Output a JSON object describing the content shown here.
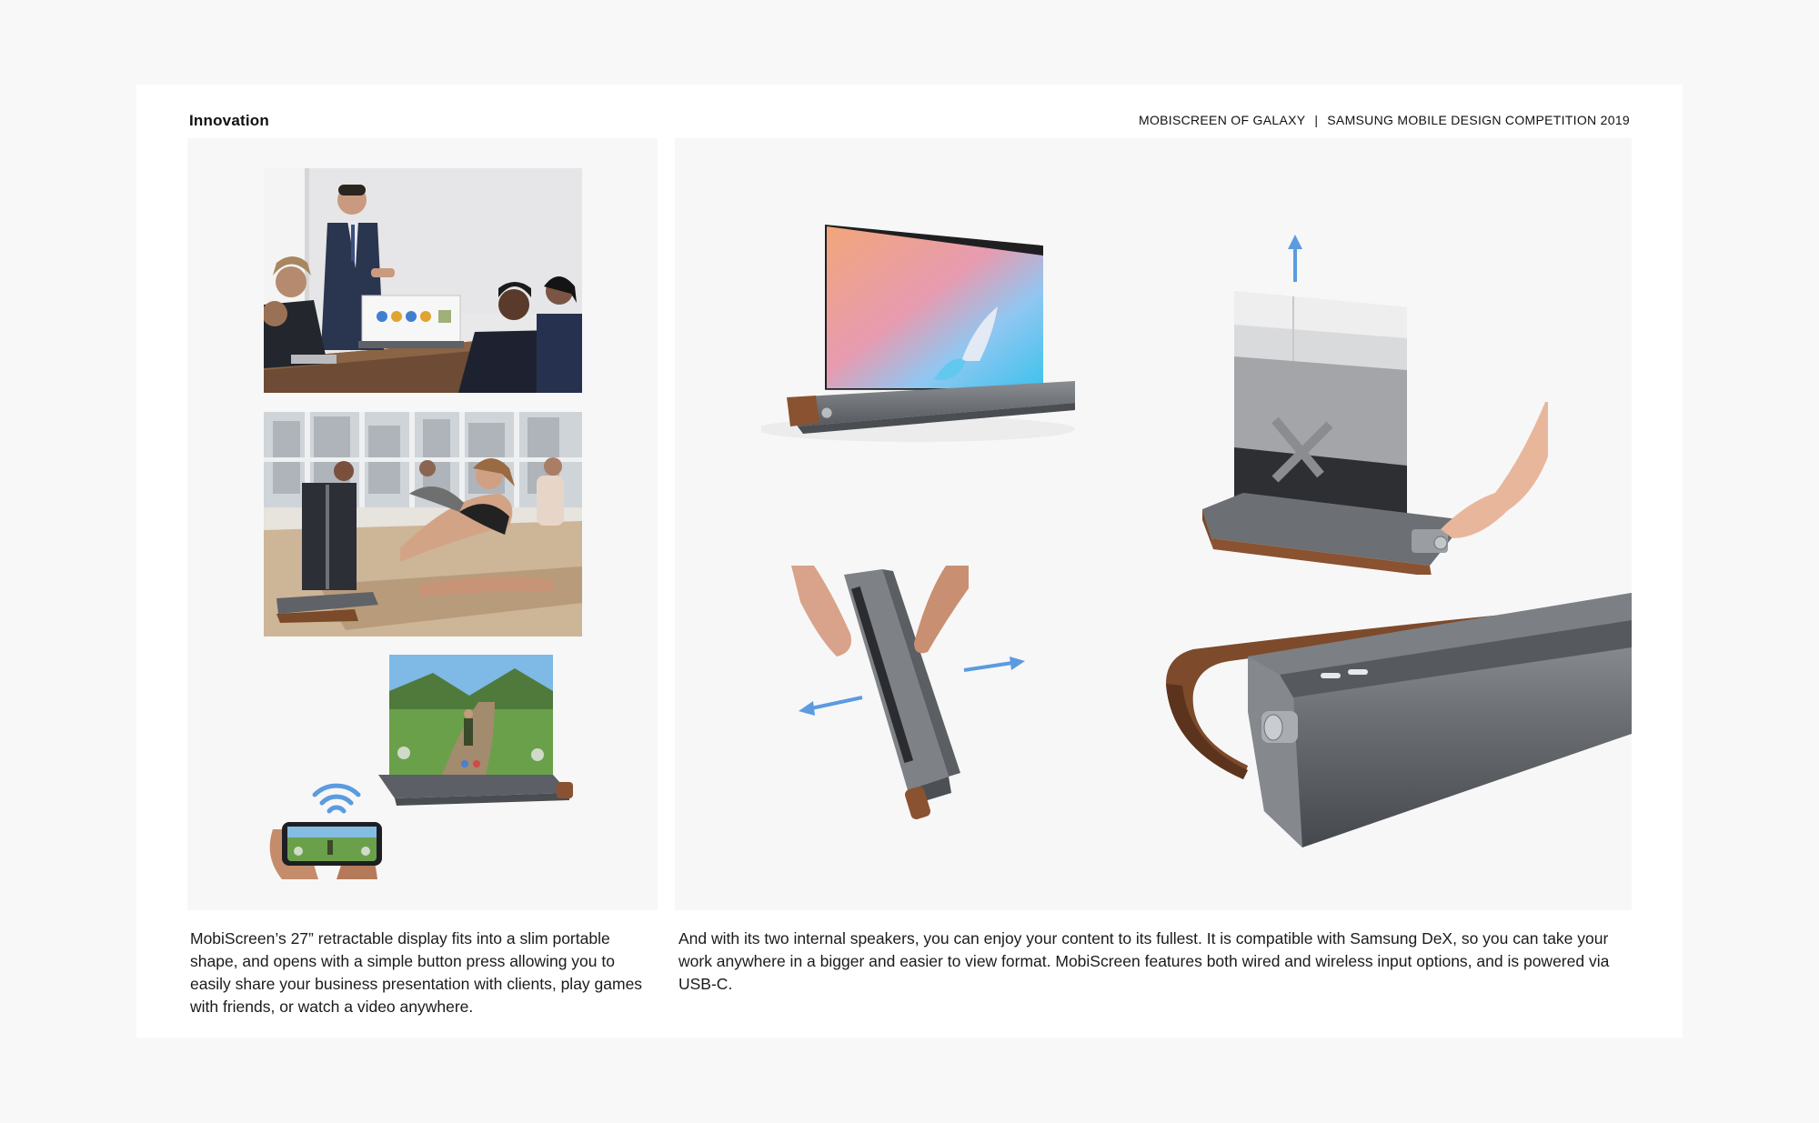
{
  "header": {
    "section_title": "Innovation",
    "project_name": "MOBISCREEN OF GALAXY",
    "separator": "|",
    "competition": "SAMSUNG MOBILE DESIGN COMPETITION 2019"
  },
  "captions": {
    "left": "MobiScreen’s 27” retractable display fits into a slim portable shape, and opens with a simple button press allowing you to easily share your business presentation with clients, play games with friends, or watch a video anywhere.",
    "right": "And with its two internal speakers, you can enjoy your content to its fullest. It is compatible with Samsung DeX, so you can take your work anywhere in a bigger and easier to view format. MobiScreen features both wired and wireless input options, and is powered via USB-C."
  },
  "colors": {
    "page_background": "#f8f8f8",
    "card_background": "#ffffff",
    "panel_background": "#f7f7f7",
    "arrow_accent": "#5b9be0",
    "leather": "#8a5230",
    "device_metal": "#6b6e73"
  }
}
